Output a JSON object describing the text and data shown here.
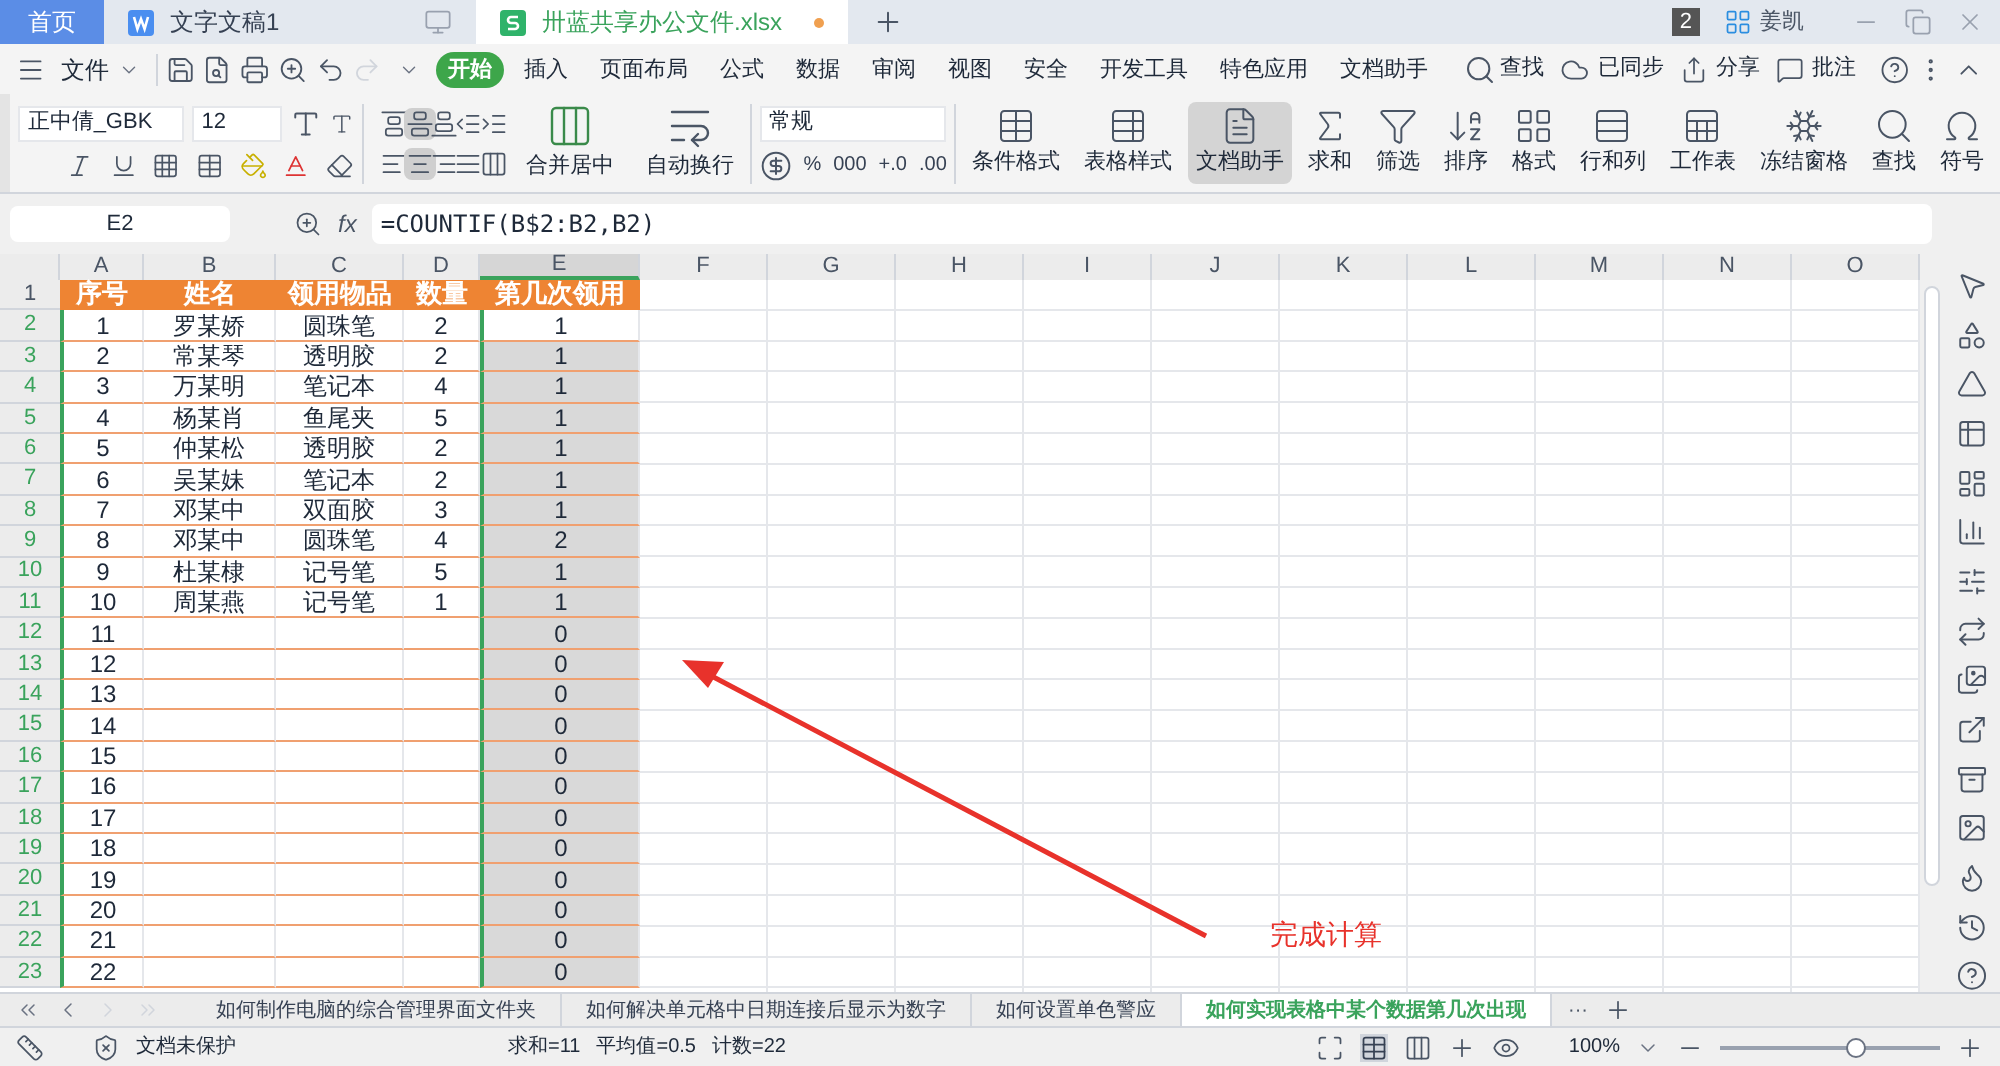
{
  "window_tabs": [
    {
      "label": "首页",
      "kind": "home",
      "selected": false
    },
    {
      "label": "文字文稿1",
      "kind": "writer",
      "selected": false
    },
    {
      "label": "卅蓝共享办公文件.xlsx",
      "kind": "sheet",
      "selected": true
    }
  ],
  "window_bar": {
    "badge": "2",
    "user": "姜凯"
  },
  "menu": {
    "file": "文件",
    "items": [
      {
        "label": "开始",
        "selected": true
      },
      {
        "label": "插入",
        "selected": false
      },
      {
        "label": "页面布局",
        "selected": false
      },
      {
        "label": "公式",
        "selected": false
      },
      {
        "label": "数据",
        "selected": false
      },
      {
        "label": "审阅",
        "selected": false
      },
      {
        "label": "视图",
        "selected": false
      },
      {
        "label": "安全",
        "selected": false
      },
      {
        "label": "开发工具",
        "selected": false
      },
      {
        "label": "特色应用",
        "selected": false
      },
      {
        "label": "文档助手",
        "selected": false
      }
    ],
    "search": "查找",
    "sync": "已同步",
    "share": "分享",
    "comment": "批注"
  },
  "ribbon": {
    "font": "正中倩_GBK",
    "size": "12",
    "merge": "合并居中",
    "wrap": "自动换行",
    "number_format": "常规",
    "number_buttons": [
      "%",
      "000",
      "+.0",
      ".00"
    ],
    "align_selected": [
      false,
      true,
      false,
      false,
      false,
      false,
      true,
      false,
      false,
      false
    ],
    "tools": [
      {
        "label": "条件格式",
        "kind": "table",
        "selected": false
      },
      {
        "label": "表格样式",
        "kind": "style",
        "selected": false
      },
      {
        "label": "文档助手",
        "kind": "doc",
        "selected": true
      },
      {
        "label": "求和",
        "kind": "sum",
        "selected": false
      },
      {
        "label": "筛选",
        "kind": "filter",
        "selected": false
      },
      {
        "label": "排序",
        "kind": "sort",
        "selected": false
      },
      {
        "label": "格式",
        "kind": "format",
        "selected": false
      },
      {
        "label": "行和列",
        "kind": "rows",
        "selected": false
      },
      {
        "label": "工作表",
        "kind": "sheet",
        "selected": false
      },
      {
        "label": "冻结窗格",
        "kind": "freeze",
        "selected": false
      },
      {
        "label": "查找",
        "kind": "find",
        "selected": false
      },
      {
        "label": "符号",
        "kind": "symbol",
        "selected": false
      }
    ]
  },
  "formula_bar": {
    "cell": "E2",
    "fx": "fx",
    "formula": "=COUNTIF(B$2:B2,B2)"
  },
  "columns": [
    {
      "label": "A",
      "selected": false
    },
    {
      "label": "B",
      "selected": false
    },
    {
      "label": "C",
      "selected": false
    },
    {
      "label": "D",
      "selected": false
    },
    {
      "label": "E",
      "selected": true
    },
    {
      "label": "F",
      "selected": false
    },
    {
      "label": "G",
      "selected": false
    },
    {
      "label": "H",
      "selected": false
    },
    {
      "label": "I",
      "selected": false
    },
    {
      "label": "J",
      "selected": false
    },
    {
      "label": "K",
      "selected": false
    },
    {
      "label": "L",
      "selected": false
    },
    {
      "label": "M",
      "selected": false
    },
    {
      "label": "N",
      "selected": false
    },
    {
      "label": "O",
      "selected": false
    }
  ],
  "header_row": {
    "num": "1",
    "cells": [
      "序号",
      "姓名",
      "领用物品",
      "数量",
      "第几次领用"
    ]
  },
  "rows": [
    {
      "num": "2",
      "selected": true,
      "active": true,
      "cells": [
        "1",
        "罗某娇",
        "圆珠笔",
        "2",
        "1"
      ]
    },
    {
      "num": "3",
      "selected": true,
      "active": false,
      "cells": [
        "2",
        "常某琴",
        "透明胶",
        "2",
        "1"
      ]
    },
    {
      "num": "4",
      "selected": true,
      "active": false,
      "cells": [
        "3",
        "万某明",
        "笔记本",
        "4",
        "1"
      ]
    },
    {
      "num": "5",
      "selected": true,
      "active": false,
      "cells": [
        "4",
        "杨某肖",
        "鱼尾夹",
        "5",
        "1"
      ]
    },
    {
      "num": "6",
      "selected": true,
      "active": false,
      "cells": [
        "5",
        "仲某松",
        "透明胶",
        "2",
        "1"
      ]
    },
    {
      "num": "7",
      "selected": true,
      "active": false,
      "cells": [
        "6",
        "吴某妹",
        "笔记本",
        "2",
        "1"
      ]
    },
    {
      "num": "8",
      "selected": true,
      "active": false,
      "cells": [
        "7",
        "邓某中",
        "双面胶",
        "3",
        "1"
      ]
    },
    {
      "num": "9",
      "selected": true,
      "active": false,
      "cells": [
        "8",
        "邓某中",
        "圆珠笔",
        "4",
        "2"
      ]
    },
    {
      "num": "10",
      "selected": true,
      "active": false,
      "cells": [
        "9",
        "杜某棣",
        "记号笔",
        "5",
        "1"
      ]
    },
    {
      "num": "11",
      "selected": true,
      "active": false,
      "cells": [
        "10",
        "周某燕",
        "记号笔",
        "1",
        "1"
      ]
    },
    {
      "num": "12",
      "selected": true,
      "active": false,
      "cells": [
        "11",
        "",
        "",
        "",
        "0"
      ]
    },
    {
      "num": "13",
      "selected": true,
      "active": false,
      "cells": [
        "12",
        "",
        "",
        "",
        "0"
      ]
    },
    {
      "num": "14",
      "selected": true,
      "active": false,
      "cells": [
        "13",
        "",
        "",
        "",
        "0"
      ]
    },
    {
      "num": "15",
      "selected": true,
      "active": false,
      "cells": [
        "14",
        "",
        "",
        "",
        "0"
      ]
    },
    {
      "num": "16",
      "selected": true,
      "active": false,
      "cells": [
        "15",
        "",
        "",
        "",
        "0"
      ]
    },
    {
      "num": "17",
      "selected": true,
      "active": false,
      "cells": [
        "16",
        "",
        "",
        "",
        "0"
      ]
    },
    {
      "num": "18",
      "selected": true,
      "active": false,
      "cells": [
        "17",
        "",
        "",
        "",
        "0"
      ]
    },
    {
      "num": "19",
      "selected": true,
      "active": false,
      "cells": [
        "18",
        "",
        "",
        "",
        "0"
      ]
    },
    {
      "num": "20",
      "selected": true,
      "active": false,
      "cells": [
        "19",
        "",
        "",
        "",
        "0"
      ]
    },
    {
      "num": "21",
      "selected": true,
      "active": false,
      "cells": [
        "20",
        "",
        "",
        "",
        "0"
      ]
    },
    {
      "num": "22",
      "selected": true,
      "active": false,
      "cells": [
        "21",
        "",
        "",
        "",
        "0"
      ]
    },
    {
      "num": "23",
      "selected": true,
      "active": false,
      "cells": [
        "22",
        "",
        "",
        "",
        "0"
      ]
    }
  ],
  "annotation": {
    "text": "完成计算"
  },
  "sheet_tabs": [
    {
      "label": "如何制作电脑的综合管理界面文件夹",
      "selected": false
    },
    {
      "label": "如何解决单元格中日期连接后显示为数字",
      "selected": false
    },
    {
      "label": "如何设置单色警应",
      "selected": false
    },
    {
      "label": "如何实现表格中某个数据第几次出现",
      "selected": true
    }
  ],
  "more_tabs": "···",
  "status_bar": {
    "protect": "文档未保护",
    "stats": [
      "求和=11",
      "平均值=0.5",
      "计数=22"
    ],
    "zoom": "100%",
    "level": 0.62
  }
}
